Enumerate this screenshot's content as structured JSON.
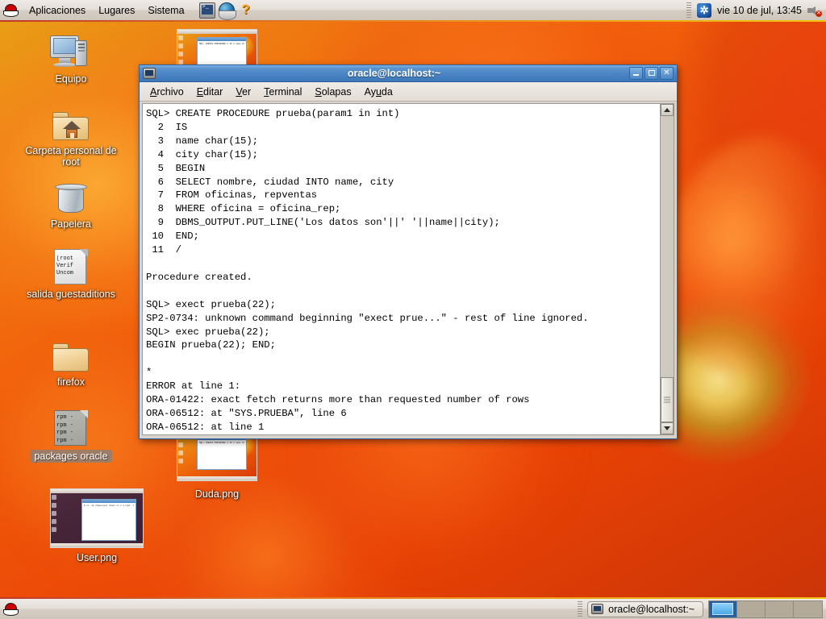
{
  "top_panel": {
    "logo": "redhat-logo",
    "menus": [
      "Aplicaciones",
      "Lugares",
      "Sistema"
    ],
    "launchers": [
      {
        "name": "terminal-launcher",
        "icon": "terminal-icon"
      },
      {
        "name": "browser-launcher",
        "icon": "globe-icon"
      },
      {
        "name": "help-launcher",
        "icon": "question-mark-icon"
      }
    ],
    "tray": {
      "bluetooth_glyph": "B",
      "clock": "vie 10 de jul, 13:45",
      "volume_icon": "speaker-muted-icon"
    }
  },
  "desktop_icons": [
    {
      "name": "equipo",
      "label": "Equipo",
      "icon": "computer-icon",
      "selected": false
    },
    {
      "name": "carpeta-personal-root",
      "label": "Carpeta personal de root",
      "icon": "home-folder-icon",
      "selected": false
    },
    {
      "name": "papelera",
      "label": "Papelera",
      "icon": "trash-icon",
      "selected": false
    },
    {
      "name": "salida-guestadditions",
      "label": "salida guestaditions",
      "icon": "text-file-icon",
      "selected": false,
      "preview_lines": [
        "[root",
        "Verif",
        "Uncom"
      ]
    },
    {
      "name": "firefox",
      "label": "firefox",
      "icon": "folder-icon",
      "selected": false
    },
    {
      "name": "packages-oracle",
      "label": "packages oracle",
      "icon": "text-file-icon",
      "selected": true,
      "preview_lines": [
        "rpm -",
        "rpm -",
        "rpm -",
        "rpm -"
      ]
    },
    {
      "name": "user-png",
      "label": "User.png",
      "icon": "image-thumbnail",
      "selected": false
    },
    {
      "name": "duda-png",
      "label": "Duda.png",
      "icon": "image-thumbnail",
      "selected": false
    }
  ],
  "terminal": {
    "title": "oracle@localhost:~",
    "icon": "terminal-icon",
    "menus": [
      {
        "name": "archivo",
        "label": "Archivo",
        "mnemonic": "A"
      },
      {
        "name": "editar",
        "label": "Editar",
        "mnemonic": "E"
      },
      {
        "name": "ver",
        "label": "Ver",
        "mnemonic": "V"
      },
      {
        "name": "terminal",
        "label": "Terminal",
        "mnemonic": "T"
      },
      {
        "name": "solapas",
        "label": "Solapas",
        "mnemonic": "S"
      },
      {
        "name": "ayuda",
        "label": "Ayuda",
        "mnemonic": "u"
      }
    ],
    "window_buttons": [
      {
        "name": "minimize-button",
        "glyph": "_"
      },
      {
        "name": "maximize-button",
        "glyph": "□"
      },
      {
        "name": "close-button",
        "glyph": "✕"
      }
    ],
    "content": "SQL> CREATE PROCEDURE prueba(param1 in int)\n  2  IS\n  3  name char(15);\n  4  city char(15);\n  5  BEGIN\n  6  SELECT nombre, ciudad INTO name, city\n  7  FROM oficinas, repventas\n  8  WHERE oficina = oficina_rep;\n  9  DBMS_OUTPUT.PUT_LINE('Los datos son'||' '||name||city);\n 10  END;\n 11  /\n\nProcedure created.\n\nSQL> exect prueba(22);\nSP2-0734: unknown command beginning \"exect prue...\" - rest of line ignored.\nSQL> exec prueba(22);\nBEGIN prueba(22); END;\n\n*\nERROR at line 1:\nORA-01422: exact fetch returns more than requested number of rows\nORA-06512: at \"SYS.PRUEBA\", line 6\nORA-06512: at line 1"
  },
  "bottom_panel": {
    "show_desktop_icon": "redhat-logo",
    "task_buttons": [
      {
        "name": "taskbar-oracle-terminal",
        "label": "oracle@localhost:~",
        "icon": "terminal-icon"
      }
    ],
    "workspaces": [
      {
        "name": "workspace-1",
        "active": true
      },
      {
        "name": "workspace-2",
        "active": false
      },
      {
        "name": "workspace-3",
        "active": false
      },
      {
        "name": "workspace-4",
        "active": false
      }
    ]
  },
  "colors": {
    "titlebar_blue": "#4a84c4",
    "panel_grey": "#e4ded7",
    "desktop_orange": "#ef6a0c",
    "terminal_bg": "#ffffff",
    "terminal_fg": "#000000",
    "selection_grey": "#828282"
  }
}
